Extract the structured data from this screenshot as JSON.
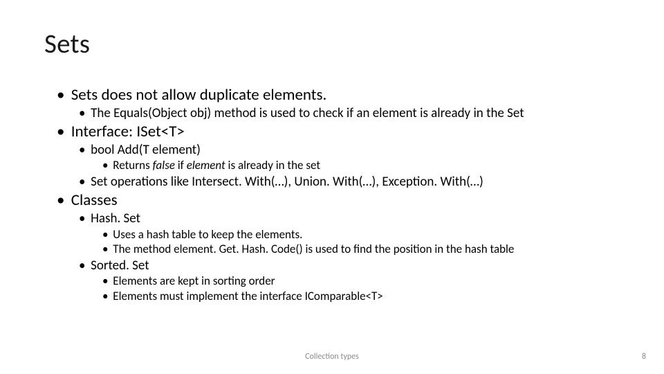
{
  "title": "Sets",
  "b1": "Sets does not allow duplicate elements.",
  "b1_1": "The Equals(Object obj) method is used to check if an element is already in the Set",
  "b2": "Interface: ISet<T>",
  "b2_1": "bool Add(T element)",
  "b2_1_1_pre": "Returns ",
  "b2_1_1_i1": "false",
  "b2_1_1_mid": " if ",
  "b2_1_1_i2": "element",
  "b2_1_1_post": " is already in the set",
  "b2_2": "Set operations like Intersect. With(…), Union. With(…), Exception. With(…)",
  "b3": "Classes",
  "b3_1": "Hash. Set",
  "b3_1_1": "Uses a hash table to keep the elements.",
  "b3_1_2": "The method element. Get. Hash. Code() is used to find the position in the hash table",
  "b3_2": "Sorted. Set",
  "b3_2_1": "Elements are kept in sorting order",
  "b3_2_2": "Elements must implement the interface IComparable<T>",
  "footer": "Collection types",
  "page": "8"
}
